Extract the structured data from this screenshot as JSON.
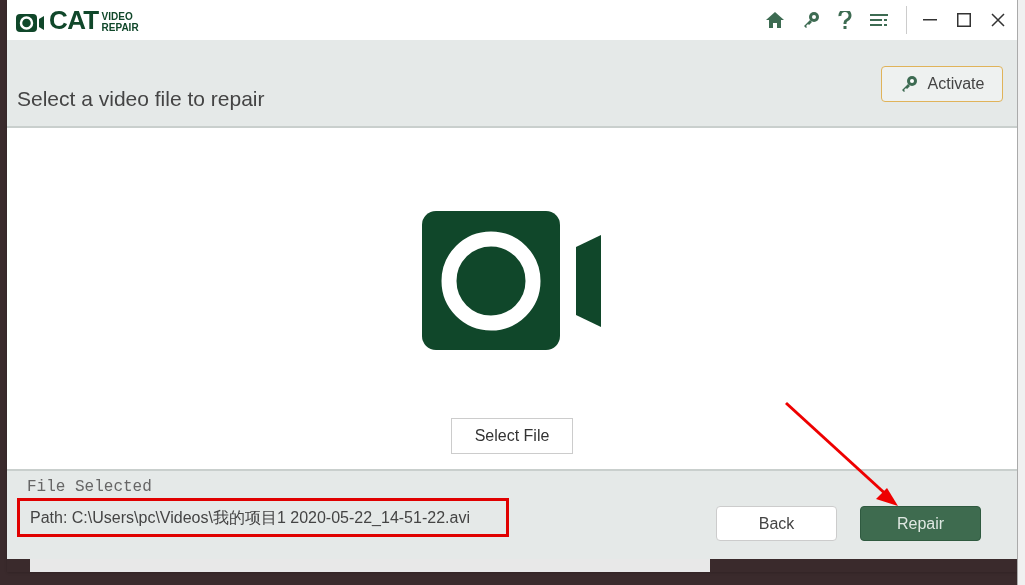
{
  "app": {
    "logo_word": "CAT",
    "logo_small": [
      "VIDEO",
      "REPAIR"
    ]
  },
  "title_bar": {
    "tools": [
      {
        "kind": "home"
      },
      {
        "kind": "key"
      },
      {
        "kind": "help"
      },
      {
        "kind": "menu"
      }
    ],
    "window_controls": [
      {
        "kind": "minimize"
      },
      {
        "kind": "maximize"
      },
      {
        "kind": "close"
      }
    ]
  },
  "header": {
    "title": "Select a video file to repair",
    "activate_button": "Activate"
  },
  "main": {
    "select_button": "Select File"
  },
  "footer": {
    "label": "File Selected",
    "path": "Path: C:\\Users\\pc\\Videos\\我的项目1 2020-05-22_14-51-22.avi",
    "back_button": "Back",
    "repair_button": "Repair"
  }
}
